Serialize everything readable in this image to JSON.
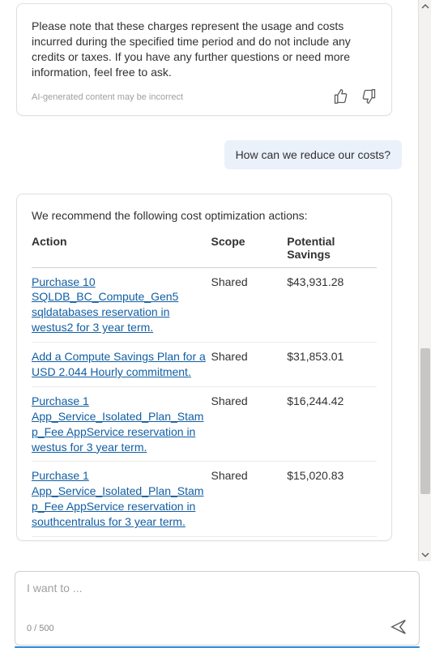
{
  "ai_message": {
    "note": "Please note that these charges represent the usage and costs incurred during the specified time period and do not include any credits or taxes. If you have any further questions or need more information, feel free to ask.",
    "disclaimer": "AI-generated content may be incorrect"
  },
  "user_message": "How can we reduce our costs?",
  "recommendation": {
    "intro": "We recommend the following cost optimization actions:",
    "columns": {
      "action": "Action",
      "scope": "Scope",
      "savings": "Potential Savings"
    },
    "rows": [
      {
        "action": "Purchase 10 SQLDB_BC_Compute_Gen5 sqldatabases reservation in westus2 for 3 year term.",
        "scope": "Shared",
        "savings": "$43,931.28"
      },
      {
        "action": "Add a Compute Savings Plan for a USD 2.044 Hourly commitment.",
        "scope": "Shared",
        "savings": "$31,853.01"
      },
      {
        "action": "Purchase 1 App_Service_Isolated_Plan_Stamp_Fee AppService reservation in westus for 3 year term.",
        "scope": "Shared",
        "savings": "$16,244.42"
      },
      {
        "action": "Purchase 1 App_Service_Isolated_Plan_Stamp_Fee AppService reservation in southcentralus for 3 year term.",
        "scope": "Shared",
        "savings": "$15,020.83"
      }
    ]
  },
  "input": {
    "placeholder": "I want to ...",
    "counter": "0 / 500"
  }
}
